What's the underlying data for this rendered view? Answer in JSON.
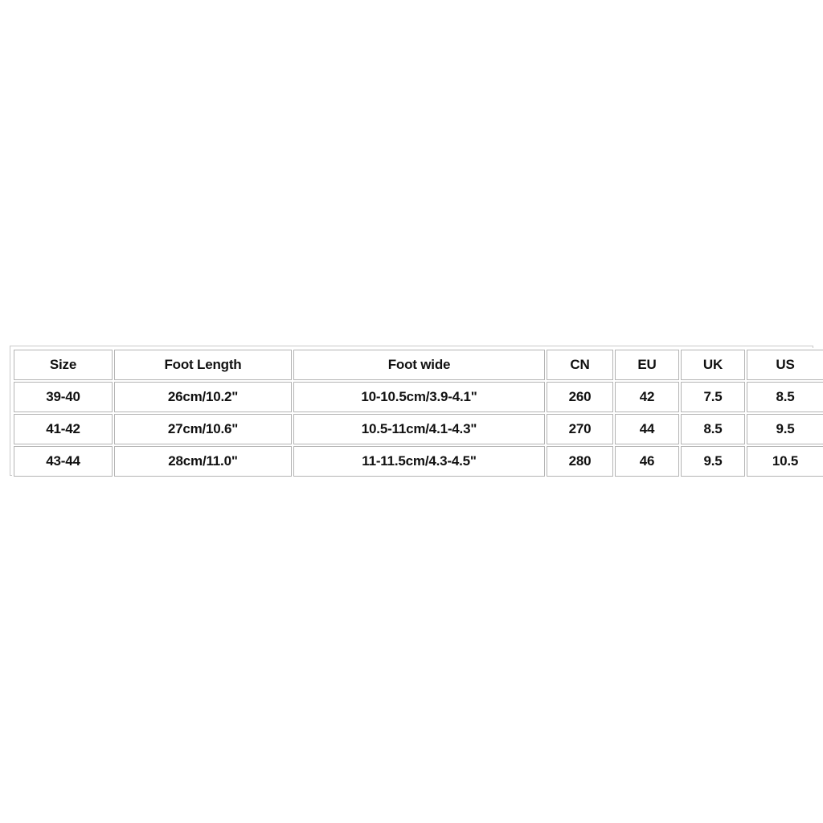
{
  "page": {
    "background_color": "#ffffff"
  },
  "size_chart": {
    "border_color": "#b4b4b4",
    "frame_color": "#c9c9c9",
    "text_color": "#111111",
    "columns": [
      {
        "key": "size",
        "label": "Size"
      },
      {
        "key": "length",
        "label": "Foot Length"
      },
      {
        "key": "wide",
        "label": "Foot wide"
      },
      {
        "key": "cn",
        "label": "CN"
      },
      {
        "key": "eu",
        "label": "EU"
      },
      {
        "key": "uk",
        "label": "UK"
      },
      {
        "key": "us",
        "label": "US"
      }
    ],
    "rows": [
      {
        "size": "39-40",
        "length": "26cm/10.2\"",
        "wide": "10-10.5cm/3.9-4.1\"",
        "cn": "260",
        "eu": "42",
        "uk": "7.5",
        "us": "8.5"
      },
      {
        "size": "41-42",
        "length": "27cm/10.6\"",
        "wide": "10.5-11cm/4.1-4.3\"",
        "cn": "270",
        "eu": "44",
        "uk": "8.5",
        "us": "9.5"
      },
      {
        "size": "43-44",
        "length": "28cm/11.0\"",
        "wide": "11-11.5cm/4.3-4.5\"",
        "cn": "280",
        "eu": "46",
        "uk": "9.5",
        "us": "10.5"
      }
    ]
  }
}
